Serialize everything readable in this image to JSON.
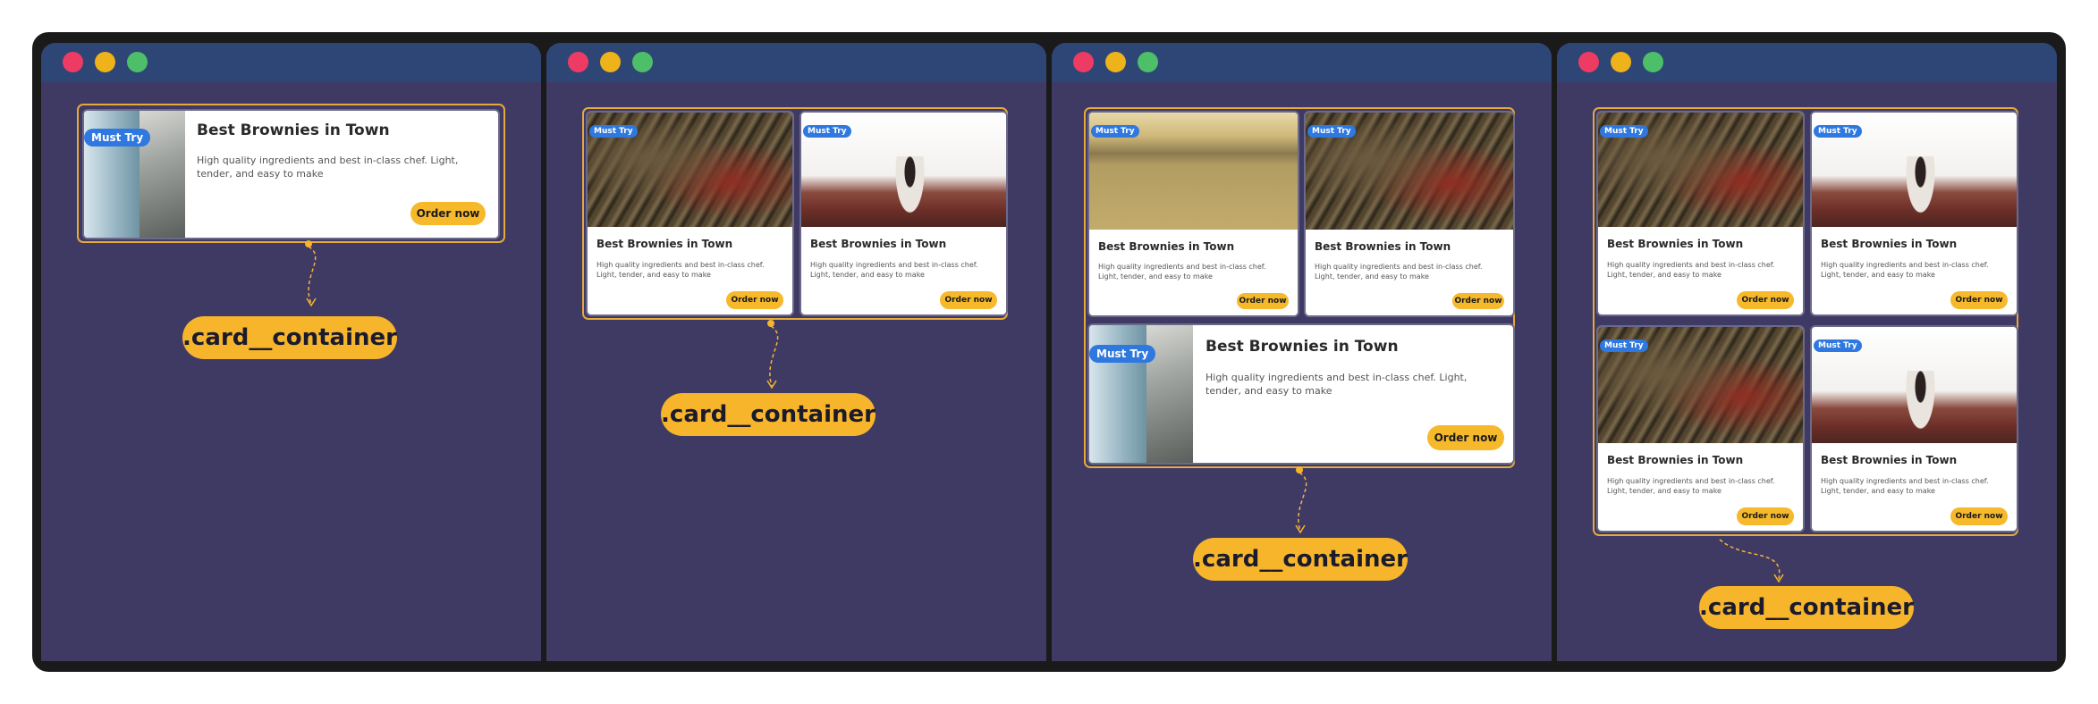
{
  "card": {
    "badge": "Must Try",
    "title": "Best Brownies in Town",
    "description": "High quality ingredients and best in-class chef. Light, tender, and easy to make",
    "button": "Order now"
  },
  "label": ".card__container",
  "colors": {
    "frame": "#1a1a1a",
    "panel_bg": "#3e3a64",
    "titlebar": "#2e4675",
    "accent": "#f7b52c",
    "badge": "#2f78e0",
    "dot_red": "#ee3b64",
    "dot_yellow": "#eeb21a",
    "dot_green": "#4dbf68"
  },
  "images": [
    "coastal-cliff",
    "tree-bark",
    "woman-desert",
    "river-city"
  ]
}
